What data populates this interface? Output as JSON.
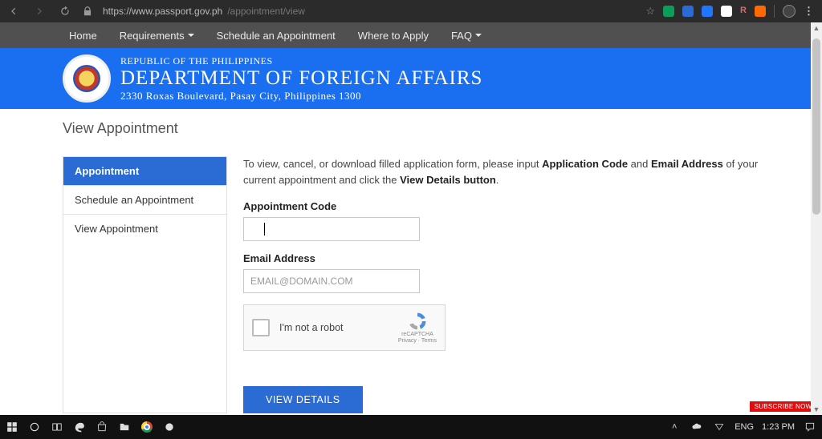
{
  "browser": {
    "url_prefix": "https://www.passport.gov.ph",
    "url_suffix": "/appointment/view"
  },
  "topnav": {
    "items": [
      {
        "label": "Home",
        "dropdown": false
      },
      {
        "label": "Requirements",
        "dropdown": true
      },
      {
        "label": "Schedule an Appointment",
        "dropdown": false
      },
      {
        "label": "Where to Apply",
        "dropdown": false
      },
      {
        "label": "FAQ",
        "dropdown": true
      }
    ]
  },
  "banner": {
    "line1": "REPUBLIC OF THE PHILIPPINES",
    "line2": "DEPARTMENT OF FOREIGN AFFAIRS",
    "line3": "2330 Roxas Boulevard, Pasay City, Philippines 1300"
  },
  "page_title": "View Appointment",
  "sidebar": {
    "items": [
      {
        "label": "Appointment",
        "active": true
      },
      {
        "label": "Schedule an Appointment",
        "active": false
      },
      {
        "label": "View Appointment",
        "active": false
      }
    ]
  },
  "instruction": {
    "pre": "To view, cancel, or download filled application form, please input ",
    "b1": "Application Code",
    "mid1": " and ",
    "b2": "Email Address",
    "mid2": " of your current appointment and click the ",
    "b3": "View Details button",
    "post": "."
  },
  "form": {
    "code_label": "Appointment Code",
    "code_value": "",
    "email_label": "Email Address",
    "email_placeholder": "EMAIL@DOMAIN.COM",
    "email_value": "",
    "captcha_label": "I'm not a robot",
    "captcha_brand": "reCAPTCHA",
    "captcha_sub": "Privacy · Terms",
    "submit_label": "VIEW DETAILS"
  },
  "subscribe_badge": "SUBSCRIBE NOW!",
  "taskbar": {
    "lang": "ENG",
    "time": "1:23 PM"
  }
}
